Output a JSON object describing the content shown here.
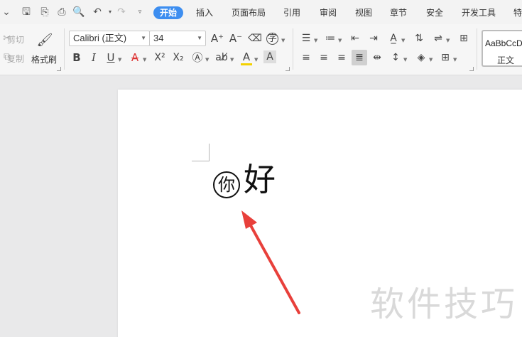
{
  "menu": {
    "tabs": [
      "开始",
      "插入",
      "页面布局",
      "引用",
      "审阅",
      "视图",
      "章节",
      "安全",
      "开发工具",
      "特"
    ],
    "active_tab": "开始"
  },
  "clipboard": {
    "cut_label": "剪切",
    "copy_label": "复制",
    "format_painter_label": "格式刷"
  },
  "font": {
    "name": "Calibri (正文)",
    "size": "34"
  },
  "styles": {
    "sample_text": "AaBbCcDd",
    "style_name": "正文"
  },
  "document": {
    "circled_char": "你",
    "plain_char": "好"
  },
  "watermark": "软件技巧",
  "colors": {
    "accent": "#3d8ef0",
    "arrow": "#e8403b",
    "font_color_bar": "#e03b3b",
    "highlight_bar": "#f3d100"
  }
}
